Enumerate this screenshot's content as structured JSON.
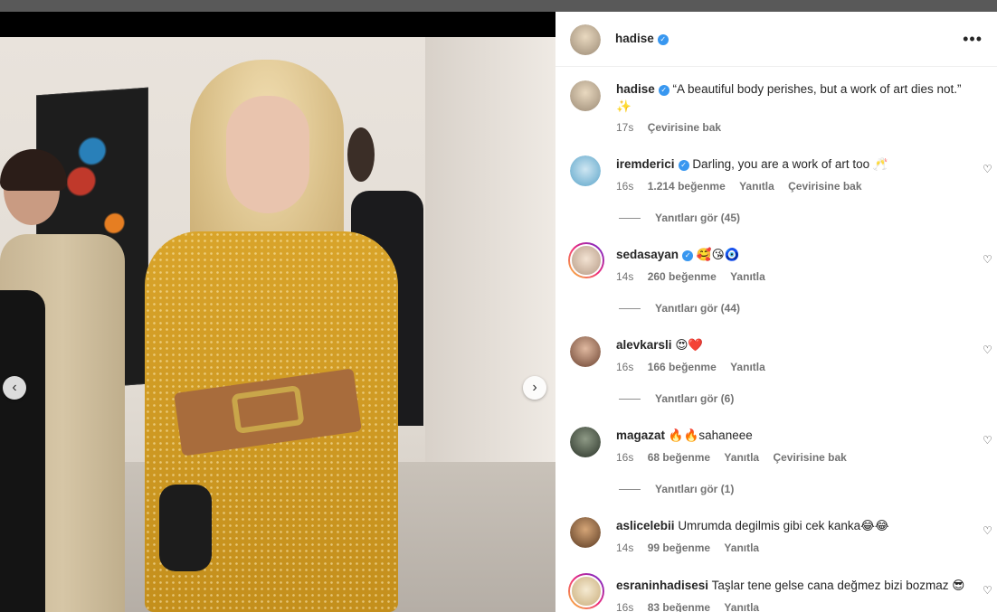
{
  "post": {
    "author": "hadise",
    "caption": "“A beautiful body perishes, but a work of art dies not.”",
    "caption_emoji": "✨",
    "time": "17s",
    "translate": "Çevirisine bak",
    "more_icon": "•••"
  },
  "nav": {
    "prev": "‹",
    "next": "›"
  },
  "ui": {
    "verified_mark": "✓",
    "heart_icon": "♡"
  },
  "comments": [
    {
      "user": "iremderici",
      "verified": true,
      "text": "Darling, you are a work of art too 🥂",
      "time": "16s",
      "likes": "1.214 beğenme",
      "reply": "Yanıtla",
      "translate": "Çevirisine bak",
      "view_replies": "Yanıtları gör (45)",
      "avatar_color": "#5aa4c9"
    },
    {
      "user": "sedasayan",
      "verified": true,
      "text": "🥰😘🧿",
      "time": "14s",
      "likes": "260 beğenme",
      "reply": "Yanıtla",
      "view_replies": "Yanıtları gör (44)",
      "avatar_color": "#d9c2b0"
    },
    {
      "user": "alevkarsli",
      "verified": false,
      "text": "😍❤️",
      "time": "16s",
      "likes": "166 beğenme",
      "reply": "Yanıtla",
      "view_replies": "Yanıtları gör (6)",
      "avatar_color": "#8a5a44"
    },
    {
      "user": "magazat",
      "verified": false,
      "text": "🔥🔥sahaneee",
      "time": "16s",
      "likes": "68 beğenme",
      "reply": "Yanıtla",
      "translate": "Çevirisine bak",
      "view_replies": "Yanıtları gör (1)",
      "avatar_color": "#3c4a3a"
    },
    {
      "user": "aslicelebii",
      "verified": false,
      "text": "Umrumda degilmis gibi cek kanka😂😂",
      "time": "14s",
      "likes": "99 beğenme",
      "reply": "Yanıtla",
      "avatar_color": "#6b4a30"
    },
    {
      "user": "esraninhadisesi",
      "verified": false,
      "text": "Taşlar tene gelse cana değmez bizi bozmaz 😎",
      "time": "16s",
      "likes": "83 beğenme",
      "reply": "Yanıtla",
      "avatar_color": "#e9d6b0"
    }
  ]
}
